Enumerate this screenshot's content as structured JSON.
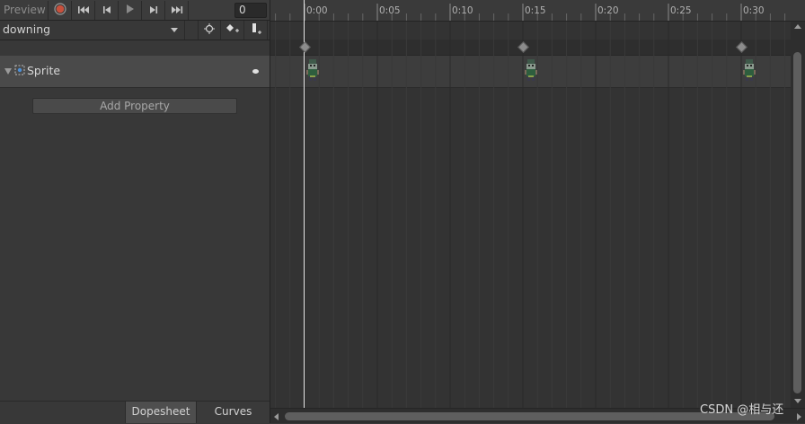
{
  "toolbar": {
    "preview_label": "Preview",
    "frame_value": "0",
    "buttons": [
      "record-icon",
      "first-key-icon",
      "prev-key-icon",
      "play-icon",
      "next-key-icon",
      "last-key-icon"
    ]
  },
  "clip": {
    "selected": "downing",
    "buttons": [
      "filter-by-selection-icon",
      "add-keyframe-icon",
      "add-event-icon"
    ]
  },
  "property": {
    "label": "Sprite",
    "icon": "sprite-renderer-icon"
  },
  "add_property_label": "Add Property",
  "tabs": {
    "dopesheet": "Dopesheet",
    "curves": "Curves"
  },
  "timeline": {
    "labels": [
      "0:00",
      "0:05",
      "0:10",
      "0:15",
      "0:20",
      "0:25",
      "0:30"
    ],
    "keyframe_times": [
      "0:00",
      "0:15",
      "0:30"
    ],
    "playhead_time": "0:00"
  },
  "colors": {
    "record": "#c8503c",
    "playhead": "#e8e8e8"
  },
  "watermark": "CSDN @相与还"
}
